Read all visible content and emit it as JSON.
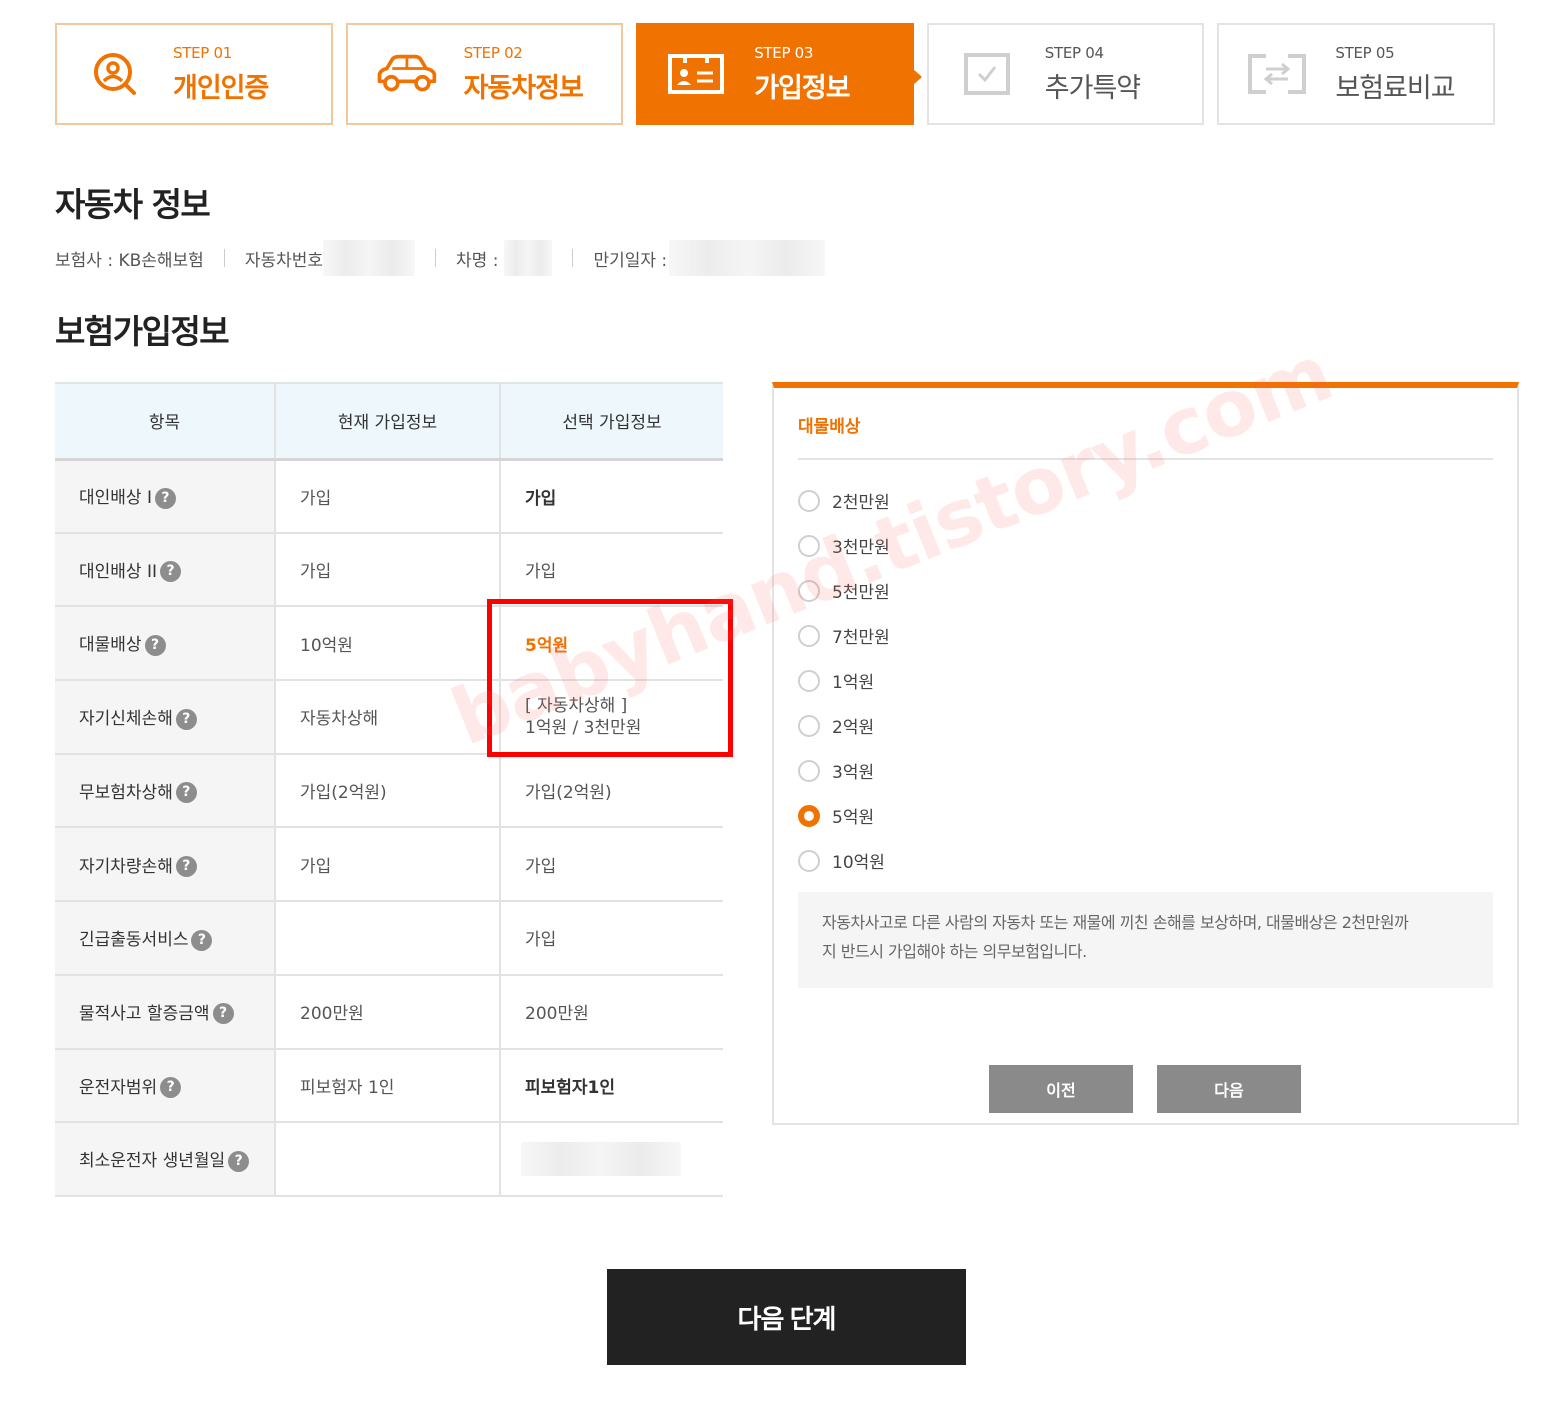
{
  "colors": {
    "accent": "#f07200",
    "header_bg": "#eef8fc",
    "red_box": "#ff0000"
  },
  "steps": [
    {
      "num": "STEP 01",
      "label": "개인인증",
      "icon": "user-search-icon",
      "state": "done"
    },
    {
      "num": "STEP 02",
      "label": "자동차정보",
      "icon": "car-icon",
      "state": "done"
    },
    {
      "num": "STEP 03",
      "label": "가입정보",
      "icon": "id-card-icon",
      "state": "active"
    },
    {
      "num": "STEP 04",
      "label": "추가특약",
      "icon": "checkbox-icon",
      "state": "inactive"
    },
    {
      "num": "STEP 05",
      "label": "보험료비교",
      "icon": "compare-icon",
      "state": "inactive"
    }
  ],
  "car_section": {
    "title": "자동차 정보",
    "insurer": "보험사 : KB손해보험",
    "plate_label": "자동차번호",
    "name_label": "차명 :",
    "expiry_label": "만기일자 :"
  },
  "insurance_section": {
    "title": "보험가입정보"
  },
  "table": {
    "headers": [
      "항목",
      "현재 가입정보",
      "선택 가입정보"
    ],
    "rows": [
      {
        "item": "대인배상 I",
        "current": "가입",
        "selected": "가입"
      },
      {
        "item": "대인배상 II",
        "current": "가입",
        "selected": "가입"
      },
      {
        "item": "대물배상",
        "current": "10억원",
        "selected": "5억원"
      },
      {
        "item": "자기신체손해",
        "current": "자동차상해",
        "selected_line1": "[ 자동차상해 ]",
        "selected_line2": "1억원 / 3천만원"
      },
      {
        "item": "무보험차상해",
        "current": "가입(2억원)",
        "selected": "가입(2억원)"
      },
      {
        "item": "자기차량손해",
        "current": "가입",
        "selected": "가입"
      },
      {
        "item": "긴급출동서비스",
        "current": "",
        "selected": "가입"
      },
      {
        "item": "물적사고 할증금액",
        "current": "200만원",
        "selected": "200만원"
      },
      {
        "item": "운전자범위",
        "current": "피보험자 1인",
        "selected": "피보험자1인"
      },
      {
        "item": "최소운전자 생년월일",
        "current": "",
        "selected": ""
      }
    ],
    "help_glyph": "?"
  },
  "panel": {
    "title": "대물배상",
    "options": [
      "2천만원",
      "3천만원",
      "5천만원",
      "7천만원",
      "1억원",
      "2억원",
      "3억원",
      "5억원",
      "10억원"
    ],
    "selected_index": 7,
    "description_line1": "자동차사고로 다른 사람의 자동차 또는 재물에 끼친 손해를 보상하며, 대물배상은 2천만원까",
    "description_line2": "지 반드시 가입해야 하는 의무보험입니다.",
    "prev_label": "이전",
    "next_label": "다음"
  },
  "next_step_label": "다음 단계",
  "watermark": "babyhand.tistory.com"
}
